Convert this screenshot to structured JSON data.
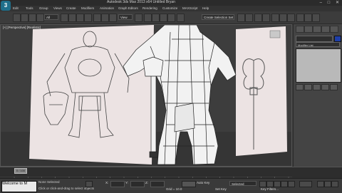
{
  "app": {
    "title": "Autodesk 3ds Max  2013 x64   Untitled  Bryan",
    "logo": "3"
  },
  "menu": {
    "items": [
      "Edit",
      "Tools",
      "Group",
      "Views",
      "Create",
      "Modifiers",
      "Animation",
      "Graph Editors",
      "Rendering",
      "Customize",
      "MAXScript",
      "Help"
    ]
  },
  "toolbar": {
    "selection_filter": "All",
    "view_dropdown": "View",
    "named_selection": "Create Selection Set"
  },
  "viewport": {
    "label": "[+] [Perspective] [Realistic]"
  },
  "command_panel": {
    "modifier_list": "Modifier List"
  },
  "timeline": {
    "frame_readout": "0 / 100",
    "ticks": [
      "0",
      "10",
      "20",
      "30",
      "40",
      "50",
      "60",
      "70",
      "80",
      "90",
      "100"
    ]
  },
  "status": {
    "maxscript_text": "Welcome to M",
    "selection_info": "None Selected",
    "prompt": "Click or click-and-drag to select objects",
    "x_label": "X:",
    "y_label": "Y:",
    "z_label": "Z:",
    "grid": "Grid = 10.0",
    "auto_key": "Auto Key",
    "selected": "Selected",
    "set_key": "Set Key",
    "key_filters": "Key Filters..."
  },
  "colors": {
    "accent": "#1f6f8b",
    "object_color": "#1f3fa8",
    "sheet": "#efe6e6"
  }
}
